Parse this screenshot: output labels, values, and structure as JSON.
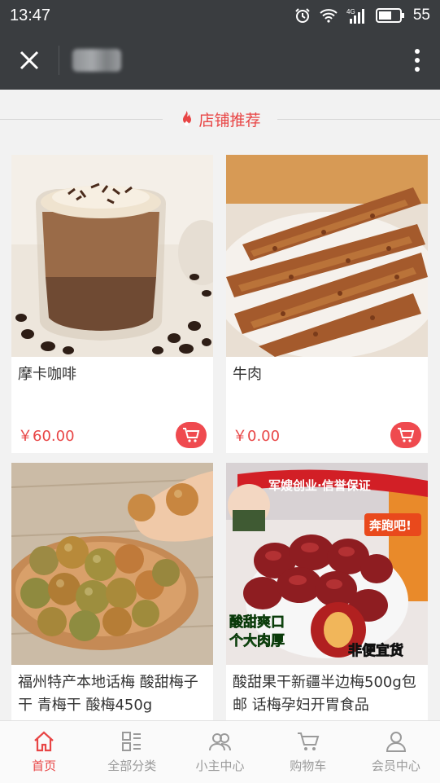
{
  "status_bar": {
    "time": "13:47",
    "battery": "55",
    "network": "4G"
  },
  "nav": {
    "close_icon": "close-icon",
    "more_icon": "more-vertical-icon"
  },
  "section": {
    "title": "店铺推荐",
    "icon": "fire-icon",
    "accent": "#e84545"
  },
  "products": [
    {
      "name": "摩卡咖啡",
      "price": "￥60.00",
      "image": "mocha-coffee-photo"
    },
    {
      "name": "牛肉",
      "price": "￥0.00",
      "image": "beef-jerky-photo"
    },
    {
      "name": "福州特产本地话梅 酸甜梅子干 青梅干 酸梅450g",
      "price": "",
      "image": "dried-plums-photo"
    },
    {
      "name": "酸甜果干新疆半边梅500g包邮 话梅孕妇开胃食品",
      "price": "",
      "image": "xinjiang-plums-ad-photo",
      "ad_text": {
        "banner": "军嫂创业·信誉保证",
        "slogan_left_1": "酸甜爽口",
        "slogan_left_2": "个大肉厚",
        "slogan_right": "非便宜货",
        "bag_text": "奔跑吧!"
      }
    }
  ],
  "tabs": [
    {
      "label": "首页",
      "icon": "home-icon",
      "active": true
    },
    {
      "label": "全部分类",
      "icon": "category-icon",
      "active": false
    },
    {
      "label": "小主中心",
      "icon": "users-icon",
      "active": false
    },
    {
      "label": "购物车",
      "icon": "cart-icon",
      "active": false
    },
    {
      "label": "会员中心",
      "icon": "user-icon",
      "active": false
    }
  ]
}
